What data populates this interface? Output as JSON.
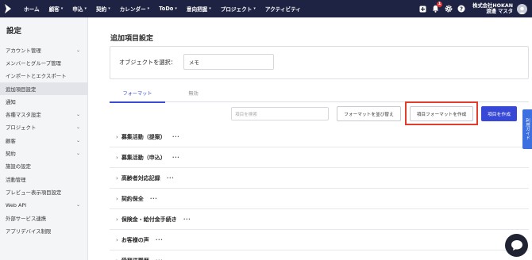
{
  "topbar": {
    "nav": [
      {
        "label": "ホーム",
        "has_menu": false
      },
      {
        "label": "顧客",
        "has_menu": true
      },
      {
        "label": "申込",
        "has_menu": true
      },
      {
        "label": "契約",
        "has_menu": true
      },
      {
        "label": "カレンダー",
        "has_menu": true
      },
      {
        "label": "ToDo",
        "has_menu": true
      },
      {
        "label": "意向把握",
        "has_menu": true
      },
      {
        "label": "プロジェクト",
        "has_menu": true
      },
      {
        "label": "アクティビティ",
        "has_menu": false
      }
    ],
    "notification_count": "1",
    "company": "株式会社HOKAN",
    "user_name": "渡邊 マスタ",
    "icons": [
      "plus-icon",
      "bell-icon",
      "gear-icon",
      "help-icon",
      "avatar"
    ]
  },
  "sidebar": {
    "title": "設定",
    "items": [
      {
        "label": "アカウント管理",
        "chevron": true
      },
      {
        "label": "メンバーとグループ管理",
        "chevron": false
      },
      {
        "label": "インポートとエクスポート",
        "chevron": false
      },
      {
        "label": "追加項目設定",
        "chevron": false
      },
      {
        "label": "通知",
        "chevron": false
      },
      {
        "label": "各種マスタ設定",
        "chevron": true
      },
      {
        "label": "プロジェクト",
        "chevron": true
      },
      {
        "label": "顧客",
        "chevron": true
      },
      {
        "label": "契約",
        "chevron": true
      },
      {
        "label": "施設の設定",
        "chevron": false
      },
      {
        "label": "活動管理",
        "chevron": false
      },
      {
        "label": "プレビュー表示項目設定",
        "chevron": false
      },
      {
        "label": "Web API",
        "chevron": true
      },
      {
        "label": "外部サービス連携",
        "chevron": false
      },
      {
        "label": "アプリデバイス制限",
        "chevron": false
      }
    ],
    "active_index": 3
  },
  "main": {
    "title": "追加項目設定",
    "object_label": "オブジェクトを選択：",
    "object_value": "メモ",
    "tabs": [
      {
        "label": "フォーマット"
      },
      {
        "label": "無効"
      }
    ],
    "search_placeholder": "項目を検索",
    "sort_button": "フォーマットを並び替え",
    "create_format_button": "項目フォーマットを作成",
    "create_item_button": "項目を作成",
    "groups": [
      "募集活動（提案）",
      "募集活動（申込）",
      "高齢者対応記録",
      "契約保全",
      "保険金・給付金手続き",
      "お客様の声",
      "受発送履歴"
    ],
    "more_symbol": "···",
    "expand_symbol": "›"
  },
  "guide_tab": "利用ガイド",
  "colors": {
    "topbar_bg": "#1f2343",
    "accent": "#3848d6",
    "highlight_box": "#e23c2c",
    "badge": "#e53935"
  }
}
